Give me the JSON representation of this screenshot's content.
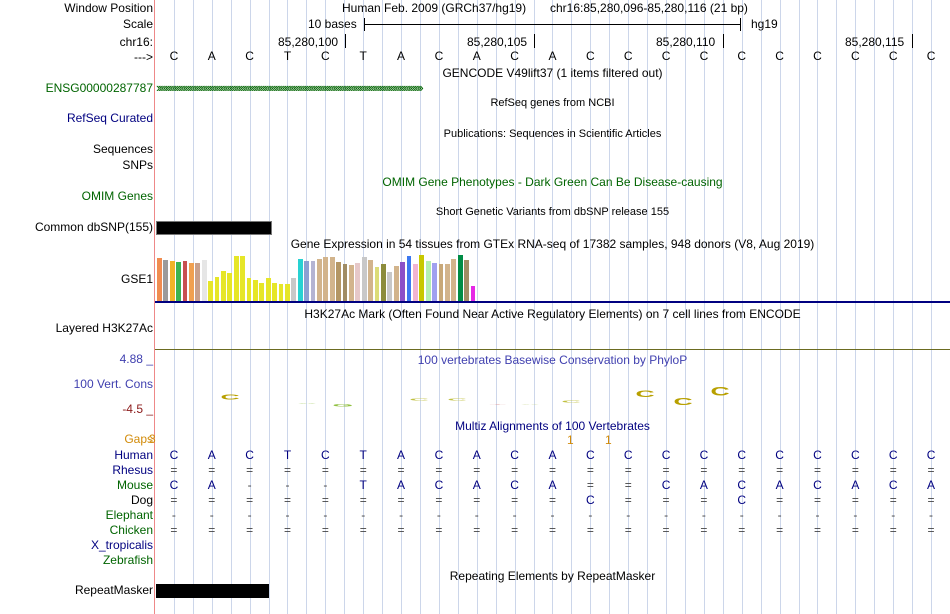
{
  "labels": {
    "window_position": "Window Position",
    "scale": "Scale",
    "chrom": "chr16:",
    "arrow": "--->",
    "gencode_track": "ENSG00000287787",
    "refseq": "RefSeq Curated",
    "sequences": "Sequences",
    "snps": "SNPs",
    "omim": "OMIM Genes",
    "dbsnp": "Common dbSNP(155)",
    "gse": "GSE1",
    "h3k27": "Layered H3K27Ac",
    "cons_max": "4.88 _",
    "cons_label": "100 Vert. Cons",
    "cons_min": "-4.5 _",
    "gaps": "Gaps",
    "repeatmasker": "RepeatMasker"
  },
  "header": {
    "assembly": "Human Feb. 2009 (GRCh37/hg19)",
    "position": "chr16:85,280,096-85,280,116 (21 bp)",
    "scale_text": "10 bases",
    "scale_db": "hg19",
    "ticks": [
      "85,280,100",
      "85,280,105",
      "85,280,110",
      "85,280,115"
    ]
  },
  "sequence": [
    "C",
    "A",
    "C",
    "T",
    "C",
    "T",
    "A",
    "C",
    "A",
    "C",
    "A",
    "C",
    "C",
    "C",
    "C",
    "C",
    "C",
    "C",
    "C",
    "C",
    "C"
  ],
  "tracks": {
    "gencode_title": "GENCODE V49lift37 (1 items filtered out)",
    "gencode_arrows": "›››››››››››››››››››››››››››››››››››››››››››››››››››››››››››››››››››››››››››››››››››››››››››››››››››››››››››››››››››››››››››››››››››››››››››››››››",
    "refseq_title": "RefSeq genes from NCBI",
    "pubs_title": "Publications: Sequences in Scientific Articles",
    "omim_title": "OMIM Gene Phenotypes - Dark Green Can Be Disease-causing",
    "dbsnp_title": "Short Genetic Variants from dbSNP release 155",
    "gtex_title": "Gene Expression in 54 tissues from GTEx RNA-seq of 17382 samples, 948 donors (V8, Aug 2019)",
    "h3k27_title": "H3K27Ac Mark (Often Found Near Active Regulatory Elements) on 7 cell lines from ENCODE",
    "cons_title": "100 vertebrates Basewise Conservation by PhyloP",
    "multiz_title": "Multiz Alignments of 100 Vertebrates",
    "repeat_title": "Repeating Elements by RepeatMasker"
  },
  "gaps_numbers": [
    "1",
    "1"
  ],
  "gaps_suffix": "3",
  "alignments": [
    {
      "species": "Human",
      "seq": [
        "C",
        "A",
        "C",
        "T",
        "C",
        "T",
        "A",
        "C",
        "A",
        "C",
        "A",
        "C",
        "C",
        "C",
        "C",
        "C",
        "C",
        "C",
        "C",
        "C",
        "C"
      ]
    },
    {
      "species": "Rhesus",
      "seq": [
        "=",
        "=",
        "=",
        "=",
        "=",
        "=",
        "=",
        "=",
        "=",
        "=",
        "=",
        "=",
        "=",
        "=",
        "=",
        "=",
        "=",
        "=",
        "=",
        "=",
        "="
      ]
    },
    {
      "species": "Mouse",
      "seq": [
        "C",
        "A",
        "-",
        "-",
        "-",
        "T",
        "A",
        "C",
        "A",
        "C",
        "A",
        "=",
        "=",
        "C",
        "A",
        "C",
        "A",
        "C",
        "A",
        "C",
        "A"
      ]
    },
    {
      "species": "Dog",
      "seq": [
        "=",
        "=",
        "=",
        "=",
        "=",
        "=",
        "=",
        "=",
        "=",
        "=",
        "=",
        "C",
        "=",
        "=",
        "=",
        "C",
        "=",
        "=",
        "=",
        "=",
        "="
      ]
    },
    {
      "species": "Elephant",
      "seq": [
        "-",
        "-",
        "-",
        "-",
        "-",
        "-",
        "-",
        "-",
        "-",
        "-",
        "-",
        "-",
        "-",
        "-",
        "-",
        "-",
        "-",
        "-",
        "-",
        "-",
        "-"
      ]
    },
    {
      "species": "Chicken",
      "seq": [
        "=",
        "=",
        "=",
        "=",
        "=",
        "=",
        "=",
        "=",
        "=",
        "=",
        "=",
        "=",
        "=",
        "=",
        "=",
        "=",
        "=",
        "=",
        "=",
        "=",
        "="
      ]
    },
    {
      "species": "X_tropicalis",
      "seq": []
    },
    {
      "species": "Zebrafish",
      "seq": []
    }
  ],
  "colors": {
    "label_green": "#006400",
    "label_navy": "#000080",
    "cons_text": "#3f3faf",
    "gaps": "#d28b0a",
    "grid": "#ccd6ea"
  },
  "gtex_bars": {
    "values": [
      0.94,
      0.89,
      0.86,
      0.84,
      0.86,
      0.82,
      0.82,
      0.89,
      0.43,
      0.52,
      0.66,
      0.6,
      0.98,
      0.98,
      0.5,
      0.45,
      0.39,
      0.49,
      0.4,
      0.36,
      0.36,
      0.51,
      0.91,
      0.86,
      0.87,
      0.91,
      0.95,
      0.96,
      0.84,
      0.8,
      0.79,
      0.83,
      0.95,
      0.9,
      0.73,
      0.8,
      0.62,
      0.76,
      0.84,
      0.97,
      0.8,
      1.0,
      0.87,
      0.82,
      0.8,
      0.81,
      0.91,
      0.99,
      0.89,
      0.32
    ],
    "colors": [
      "#f08c50",
      "#9b9b9b",
      "#f0b428",
      "#3cb450",
      "#c85050",
      "#f0a050",
      "#c8a08c",
      "#e6e6e6",
      "#e6e628",
      "#e6e628",
      "#e6e628",
      "#e6e628",
      "#e6e628",
      "#e6e628",
      "#e6e628",
      "#e6e628",
      "#e6e628",
      "#e6e628",
      "#e6e628",
      "#e6e628",
      "#e6e628",
      "#c8c8c8",
      "#28d2d2",
      "#8ca0d2",
      "#b4b4d2",
      "#d2b48c",
      "#d2b48c",
      "#d2b48c",
      "#b49664",
      "#a08c64",
      "#d2b48c",
      "#e6c8c8",
      "#c8c8c8",
      "#d2b48c",
      "#dcdc78",
      "#8c8c3c",
      "#c8c8c8",
      "#d2b48c",
      "#8c50c8",
      "#3c78f0",
      "#f0b4d2",
      "#c8c800",
      "#b4f0b4",
      "#a0a0f0",
      "#c8a878",
      "#d2b48c",
      "#d2b48c",
      "#008c46",
      "#a08c64",
      "#e628e6"
    ]
  },
  "conservation": [
    {
      "base": "C",
      "color": "#b8a000",
      "h": 6
    },
    {
      "base": "A",
      "color": "#90c040",
      "h": 1
    },
    {
      "base": "G",
      "color": "#90c040",
      "h": 3
    },
    {
      "base": "C",
      "color": "#c0c040",
      "h": 2
    },
    {
      "base": "C",
      "color": "#c0c040",
      "h": 2
    },
    {
      "base": "T",
      "color": "#e0a0a0",
      "h": 1
    },
    {
      "base": "A",
      "color": "#c0d080",
      "h": 1
    },
    {
      "base": "C",
      "color": "#c0c040",
      "h": 2
    },
    {
      "base": "C",
      "color": "#b8a000",
      "h": 8
    },
    {
      "base": "C",
      "color": "#b8a000",
      "h": 9
    },
    {
      "base": "C",
      "color": "#b8a000",
      "h": 10
    }
  ]
}
